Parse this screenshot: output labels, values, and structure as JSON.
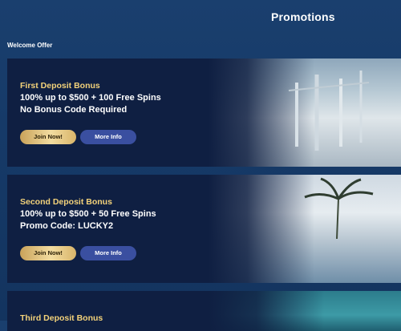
{
  "header": {
    "title": "Promotions"
  },
  "section": {
    "label": "Welcome Offer"
  },
  "cards": [
    {
      "title": "First Deposit Bonus",
      "line1": "100% up to $500 + 100 Free Spins",
      "line2": "No Bonus Code Required",
      "join_label": "Join Now!",
      "info_label": "More Info"
    },
    {
      "title": "Second Deposit Bonus",
      "line1": "100% up to $500 + 50 Free Spins",
      "line2": "Promo Code: LUCKY2",
      "join_label": "Join Now!",
      "info_label": "More Info"
    },
    {
      "title": "Third Deposit Bonus"
    }
  ],
  "colors": {
    "background": "#163a68",
    "card": "#0f1f42",
    "title_gold": "#f3d27a",
    "info_button": "#3a4fa0"
  }
}
